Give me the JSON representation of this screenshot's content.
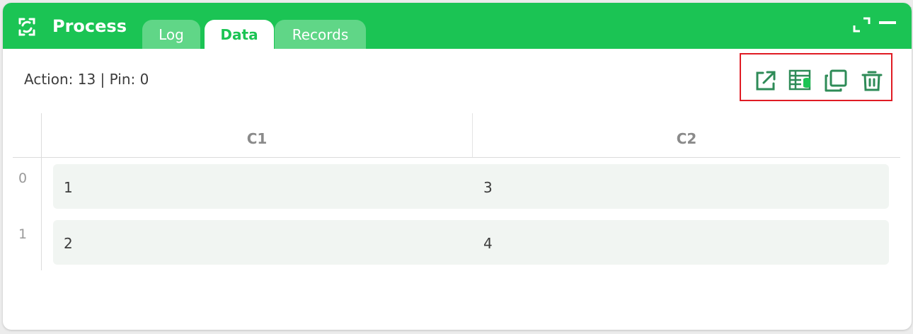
{
  "header": {
    "title": "Process",
    "tabs": [
      {
        "label": "Log",
        "active": false
      },
      {
        "label": "Data",
        "active": true
      },
      {
        "label": "Records",
        "active": false
      }
    ],
    "window_icons": [
      "expand-icon",
      "minimize-icon"
    ]
  },
  "status": "Action: 13 | Pin: 0",
  "toolbar": {
    "icons": [
      "open-external-icon",
      "table-data-icon",
      "copy-icon",
      "trash-icon"
    ]
  },
  "table": {
    "columns": [
      "C1",
      "C2"
    ],
    "rows": [
      {
        "index": "0",
        "cells": [
          "1",
          "3"
        ]
      },
      {
        "index": "1",
        "cells": [
          "2",
          "4"
        ]
      }
    ]
  },
  "colors": {
    "header_green": "#1bc454",
    "tab_inactive": "#60d687",
    "icon_green": "#2e8b57",
    "highlight_red": "#e01b24",
    "row_bg": "#f1f5f2"
  }
}
